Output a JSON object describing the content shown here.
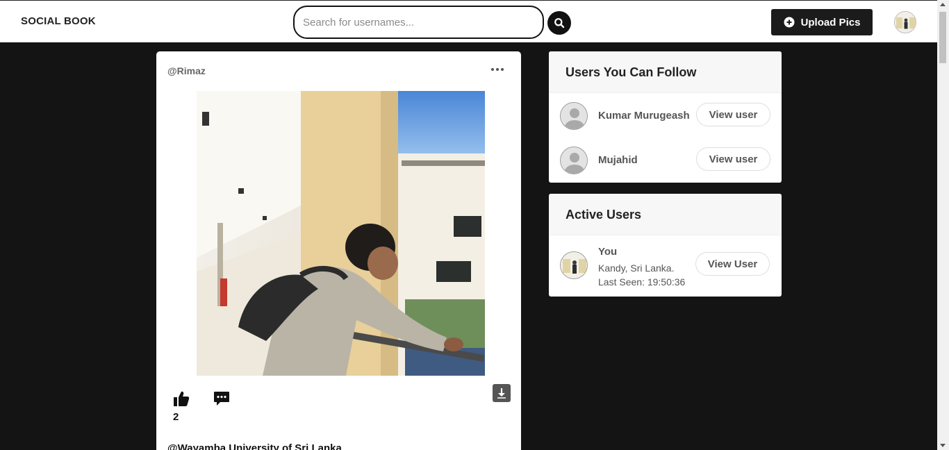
{
  "header": {
    "brand": "SOCIAL BOOK",
    "search_placeholder": "Search for usernames...",
    "upload_label": "Upload Pics"
  },
  "post": {
    "username": "@Rimaz",
    "likes": "2",
    "caption": "@Wayamba University of Sri Lanka"
  },
  "follow_card": {
    "title": "Users You Can Follow",
    "users": [
      {
        "name": "Kumar Murugeash",
        "button": "View user"
      },
      {
        "name": "Mujahid",
        "button": "View user"
      }
    ]
  },
  "active_card": {
    "title": "Active Users",
    "user": {
      "name": "You",
      "location": "Kandy, Sri Lanka.",
      "last_seen": "Last Seen: 19:50:36",
      "button": "View User"
    }
  },
  "colors": {
    "page_bg": "#141414",
    "header_bg": "#ffffff",
    "button_dark": "#1b1b1b",
    "card_head_bg": "#f7f7f8"
  },
  "icons": [
    "search-icon",
    "plus-circle-icon",
    "more-dots-icon",
    "thumbs-up-icon",
    "comment-icon",
    "download-icon",
    "default-avatar-icon"
  ]
}
